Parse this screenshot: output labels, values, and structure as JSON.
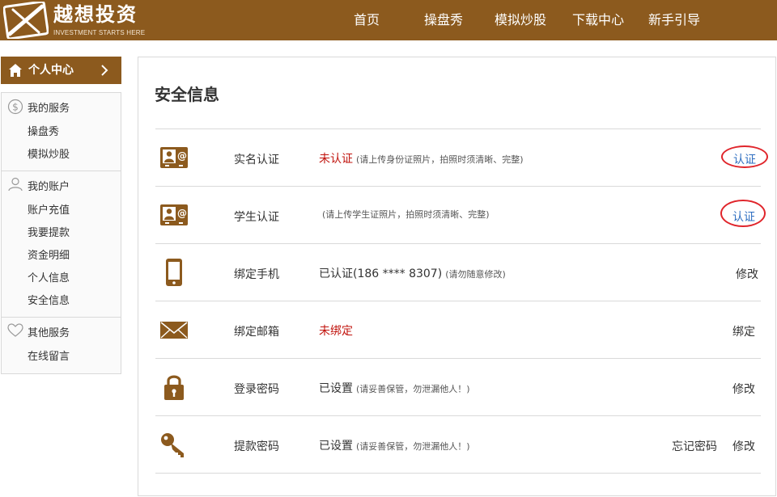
{
  "header": {
    "brand_name": "越想投资",
    "brand_slogan": "INVESTMENT STARTS HERE",
    "nav": [
      "首页",
      "操盘秀",
      "模拟炒股",
      "下载中心",
      "新手引导"
    ]
  },
  "sidebar": {
    "title": "个人中心",
    "groups": [
      {
        "title": "我的服务",
        "icon": "dollar-icon",
        "items": [
          "操盘秀",
          "模拟炒股"
        ]
      },
      {
        "title": "我的账户",
        "icon": "user-icon",
        "items": [
          "账户充值",
          "我要提款",
          "资金明细",
          "个人信息",
          "安全信息"
        ]
      },
      {
        "title": "其他服务",
        "icon": "heart-icon",
        "items": [
          "在线留言"
        ]
      }
    ]
  },
  "main": {
    "title": "安全信息",
    "rows": [
      {
        "icon": "id-card-icon",
        "label": "实名认证",
        "status": "未认证",
        "hint": "(请上传身份证照片，拍照时须清晰、完整)",
        "action": "认证"
      },
      {
        "icon": "id-card-icon",
        "label": "学生认证",
        "status": "",
        "hint": "(请上传学生证照片，拍照时须清晰、完整)",
        "action": "认证"
      },
      {
        "icon": "phone-icon",
        "label": "绑定手机",
        "status": "已认证(186 **** 8307)",
        "hint": "(请勿随意修改)",
        "action": "修改"
      },
      {
        "icon": "mail-icon",
        "label": "绑定邮箱",
        "status": "未绑定",
        "hint": "",
        "action": "绑定"
      },
      {
        "icon": "lock-icon",
        "label": "登录密码",
        "status": "已设置",
        "hint": "(请妥善保管，勿泄漏他人！)",
        "action": "修改"
      },
      {
        "icon": "key-icon",
        "label": "提款密码",
        "status": "已设置",
        "hint": "(请妥善保管，勿泄漏他人！)",
        "action": "修改",
        "extra_action": "忘记密码"
      }
    ]
  },
  "colors": {
    "brand": "#8c5a1e",
    "alert": "#c1140e",
    "link": "#2f6fc1",
    "highlight_ring": "#e0252b"
  }
}
